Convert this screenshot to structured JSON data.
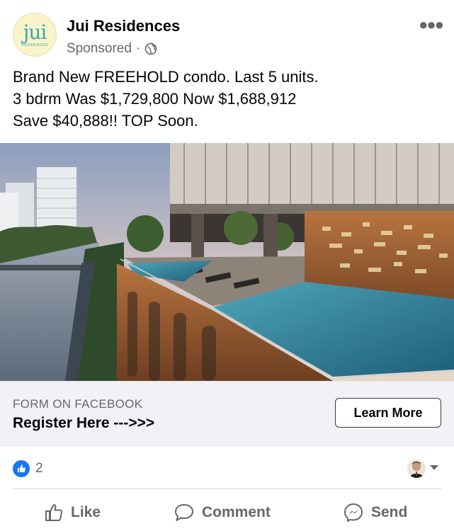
{
  "post": {
    "page_name": "Jui Residences",
    "sponsored_label": "Sponsored",
    "separator": "·",
    "avatar_logo_text": "jui",
    "avatar_logo_sub": "RESIDENCES",
    "text_lines": [
      "Brand New FREEHOLD condo. Last 5 units.",
      "3 bdrm Was $1,729,800 Now $1,688,912",
      "Save $40,888!! TOP Soon."
    ],
    "icons": {
      "privacy": "globe-icon",
      "more": "more-options-icon",
      "reaction": "like-reaction-icon",
      "like_action": "thumbs-up-icon",
      "comment_action": "comment-bubble-icon",
      "send_action": "messenger-icon"
    }
  },
  "cta": {
    "caption": "FORM ON FACEBOOK",
    "headline": "Register Here --->>>",
    "button_label": "Learn More"
  },
  "reactions": {
    "like_count": "2"
  },
  "actions": {
    "like": "Like",
    "comment": "Comment",
    "send": "Send"
  },
  "colors": {
    "facebook_blue": "#1877f2",
    "secondary_text": "#65676b",
    "cta_background": "#f0f2f5",
    "logo_teal": "#33a9b2"
  }
}
